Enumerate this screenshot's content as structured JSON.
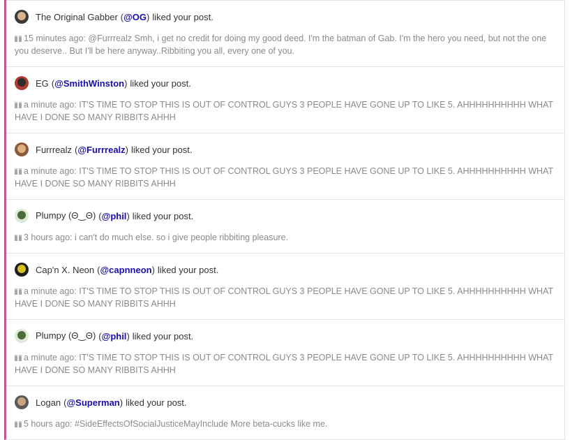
{
  "colors": {
    "accent_border": "#c2549a",
    "handle": "#1a0dab",
    "body_text": "#8a8a8a",
    "name_text": "#333333"
  },
  "notifications": [
    {
      "avatar_icon": "avatar-gabber-icon",
      "avatar_bg": "#3a3a3a",
      "avatar_face": "#d9b38c",
      "name": "The Original Gabber",
      "handle": "@OG",
      "action": "liked your post.",
      "quote_icon": "quote-icon",
      "body": "15 minutes ago: @Furrrealz Smh, i get no credit for doing my good deed. I'm the batman of Gab. I'm the hero you need, but not the one you deserve.. But I'll be here anyway..Ribbiting you all, every one of you."
    },
    {
      "avatar_icon": "avatar-smithwinston-icon",
      "avatar_bg": "#b13b2e",
      "avatar_face": "#2d2d2d",
      "name": "EG",
      "handle": "@SmithWinston",
      "action": "liked your post.",
      "quote_icon": "quote-icon",
      "body": "a minute ago: IT'S TIME TO STOP THIS IS OUT OF CONTROL GUYS 3 PEOPLE HAVE GONE UP TO LIKE 5. AHHHHHHHHHH WHAT HAVE I DONE SO MANY RIBBITS AHHH"
    },
    {
      "avatar_icon": "avatar-furrrealz-icon",
      "avatar_bg": "#8a5a3c",
      "avatar_face": "#e0b083",
      "name": "Furrrealz",
      "handle": "@Furrrealz",
      "action": "liked your post.",
      "quote_icon": "quote-icon",
      "body": "a minute ago: IT'S TIME TO STOP THIS IS OUT OF CONTROL GUYS 3 PEOPLE HAVE GONE UP TO LIKE 5. AHHHHHHHHHH WHAT HAVE I DONE SO MANY RIBBITS AHHH"
    },
    {
      "avatar_icon": "avatar-phil-icon",
      "avatar_bg": "#dfe9d6",
      "avatar_face": "#4a6b3a",
      "name": "Plumpy (Θ‿Θ)",
      "handle": "@phil",
      "action": "liked your post.",
      "quote_icon": "quote-icon",
      "body": "3 hours ago: i can't do much else. so i give people ribbiting pleasure."
    },
    {
      "avatar_icon": "avatar-capnneon-icon",
      "avatar_bg": "#1f1f1f",
      "avatar_face": "#d6c21e",
      "name": "Cap'n X. Neon",
      "handle": "@capnneon",
      "action": "liked your post.",
      "quote_icon": "quote-icon",
      "body": "a minute ago: IT'S TIME TO STOP THIS IS OUT OF CONTROL GUYS 3 PEOPLE HAVE GONE UP TO LIKE 5. AHHHHHHHHHH WHAT HAVE I DONE SO MANY RIBBITS AHHH"
    },
    {
      "avatar_icon": "avatar-phil-icon",
      "avatar_bg": "#dfe9d6",
      "avatar_face": "#4a6b3a",
      "name": "Plumpy (Θ‿Θ)",
      "handle": "@phil",
      "action": "liked your post.",
      "quote_icon": "quote-icon",
      "body": "a minute ago: IT'S TIME TO STOP THIS IS OUT OF CONTROL GUYS 3 PEOPLE HAVE GONE UP TO LIKE 5. AHHHHHHHHHH WHAT HAVE I DONE SO MANY RIBBITS AHHH"
    },
    {
      "avatar_icon": "avatar-superman-icon",
      "avatar_bg": "#5a5a5a",
      "avatar_face": "#c9a37e",
      "name": "Logan",
      "handle": "@Superman",
      "action": "liked your post.",
      "quote_icon": "quote-icon",
      "body": "5 hours ago: #SideEffectsOfSocialJusticeMayInclude More beta-cucks like me."
    }
  ]
}
